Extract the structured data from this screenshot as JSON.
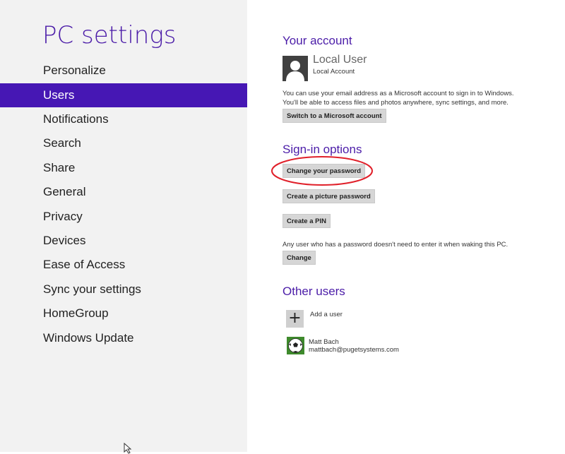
{
  "sidebar": {
    "title": "PC settings",
    "items": [
      {
        "label": "Personalize"
      },
      {
        "label": "Users"
      },
      {
        "label": "Notifications"
      },
      {
        "label": "Search"
      },
      {
        "label": "Share"
      },
      {
        "label": "General"
      },
      {
        "label": "Privacy"
      },
      {
        "label": "Devices"
      },
      {
        "label": "Ease of Access"
      },
      {
        "label": "Sync your settings"
      },
      {
        "label": "HomeGroup"
      },
      {
        "label": "Windows Update"
      }
    ],
    "selected_index": 1
  },
  "account": {
    "heading": "Your account",
    "user_name": "Local User",
    "account_type": "Local Account",
    "description": "You can use your email address as a Microsoft account to sign in to Windows. You'll be able to access files and photos anywhere, sync settings, and more.",
    "switch_button": "Switch to a Microsoft account"
  },
  "signin": {
    "heading": "Sign-in options",
    "change_password_button": "Change your password",
    "picture_password_button": "Create a picture password",
    "pin_button": "Create a PIN",
    "waking_text": "Any user who has a password doesn't need to enter it when waking this PC.",
    "change_button": "Change"
  },
  "other_users": {
    "heading": "Other users",
    "add_user_label": "Add a user",
    "users": [
      {
        "name": "Matt Bach",
        "email": "mattbach@pugetsystems.com"
      }
    ]
  },
  "colors": {
    "accent": "#4617b4",
    "heading": "#4b1ca8",
    "highlight_annotation": "#e0202a"
  }
}
